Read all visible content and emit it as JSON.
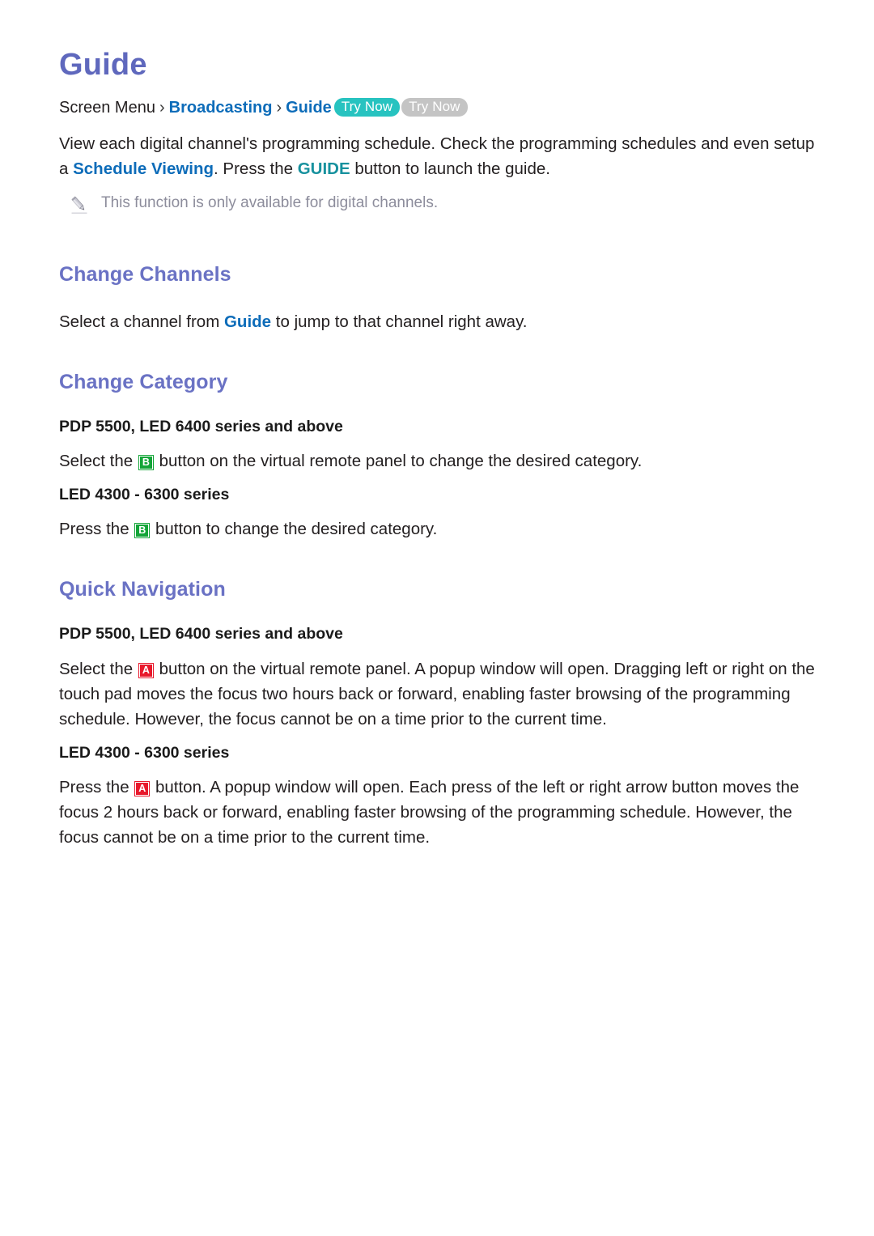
{
  "page": {
    "title": "Guide"
  },
  "breadcrumb": {
    "root": "Screen Menu",
    "sep": "›",
    "item1": "Broadcasting",
    "item2": "Guide",
    "badge_primary": "Try Now",
    "badge_secondary": "Try Now"
  },
  "intro": {
    "part1": "View each digital channel's programming schedule. Check the programming schedules and even setup a ",
    "link1": "Schedule Viewing",
    "part2": ". Press the ",
    "link2": "GUIDE",
    "part3": " button to launch the guide.",
    "note_icon": "pencil-icon",
    "note": "This function is only available for digital channels."
  },
  "sections": [
    {
      "heading": "Change Channels",
      "paragraph_pre": "Select a channel from ",
      "paragraph_link": "Guide",
      "paragraph_post": " to jump to that channel right away."
    },
    {
      "heading": "Change Category",
      "block1": {
        "sub_heading": "PDP 5500, LED 6400 series and above",
        "text_pre": "Select the ",
        "key": "B",
        "key_color": "#13a538",
        "text_post": " button on the virtual remote panel to change the desired category."
      },
      "block2": {
        "sub_heading": "LED 4300 - 6300 series",
        "text_pre": "Press the ",
        "key": "B",
        "key_color": "#13a538",
        "text_post": " button to change the desired category."
      }
    },
    {
      "heading": "Quick Navigation",
      "block1": {
        "sub_heading": "PDP 5500, LED 6400 series and above",
        "text_pre": "Select the ",
        "key": "A",
        "key_color": "#e8192c",
        "text_post": " button on the virtual remote panel. A popup window will open. Dragging left or right on the touch pad moves the focus two hours back or forward, enabling faster browsing of the programming schedule. However, the focus cannot be on a time prior to the current time."
      },
      "block2": {
        "sub_heading": "LED 4300 - 6300 series",
        "text_pre": "Press the ",
        "key": "A",
        "key_color": "#e8192c",
        "text_post": " button. A popup window will open. Each press of the left or right arrow button moves the focus 2 hours back or forward, enabling faster browsing of the programming schedule. However, the focus cannot be on a time prior to the current time."
      }
    }
  ],
  "colors": {
    "title": "#5f68bd",
    "heading": "#6a72c4",
    "link": "#0d6cb9",
    "teal_link": "#17919e",
    "badge_teal": "#27c3c0",
    "badge_gray": "#c4c4c4",
    "note_text": "#8d8d9c",
    "body_text": "#231f20"
  }
}
